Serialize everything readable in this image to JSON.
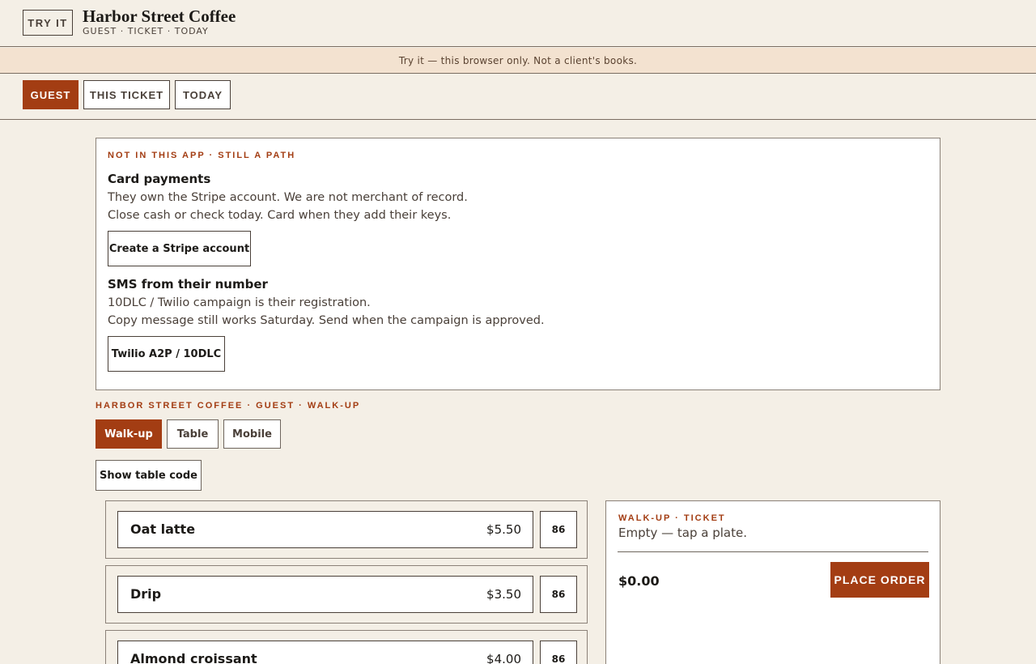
{
  "header": {
    "badge": "TRY IT",
    "title": "Harbor Street Coffee",
    "subtitle": "GUEST · TICKET · TODAY"
  },
  "notice": "Try it — this browser only. Not a client's books.",
  "tabs": [
    {
      "label": "GUEST",
      "active": true
    },
    {
      "label": "THIS TICKET",
      "active": false
    },
    {
      "label": "TODAY",
      "active": false
    }
  ],
  "path_card": {
    "eyebrow": "NOT IN THIS APP · STILL A PATH",
    "sections": [
      {
        "heading": "Card payments",
        "lines": [
          "They own the Stripe account. We are not merchant of record.",
          "Close cash or check today. Card when they add their keys."
        ],
        "button": "Create a Stripe account"
      },
      {
        "heading": "SMS from their number",
        "lines": [
          "10DLC / Twilio campaign is their registration.",
          "Copy message still works Saturday. Send when the campaign is approved."
        ],
        "button": "Twilio A2P / 10DLC"
      }
    ]
  },
  "guest": {
    "eyebrow": "HARBOR STREET COFFEE · GUEST · WALK-UP",
    "modes": [
      {
        "label": "Walk-up",
        "active": true
      },
      {
        "label": "Table",
        "active": false
      },
      {
        "label": "Mobile",
        "active": false
      }
    ],
    "table_code_button": "Show table code"
  },
  "menu": [
    {
      "name": "Oat latte",
      "price": "$5.50",
      "eighty_six": "86"
    },
    {
      "name": "Drip",
      "price": "$3.50",
      "eighty_six": "86"
    },
    {
      "name": "Almond croissant",
      "price": "$4.00",
      "eighty_six": "86"
    }
  ],
  "ticket": {
    "eyebrow": "WALK-UP · TICKET",
    "empty_text": "Empty — tap a plate.",
    "total": "$0.00",
    "place_order": "PLACE ORDER"
  },
  "colors": {
    "accent": "#a33d13",
    "background": "#f4efe6",
    "notice_bg": "#f3e2d0"
  }
}
